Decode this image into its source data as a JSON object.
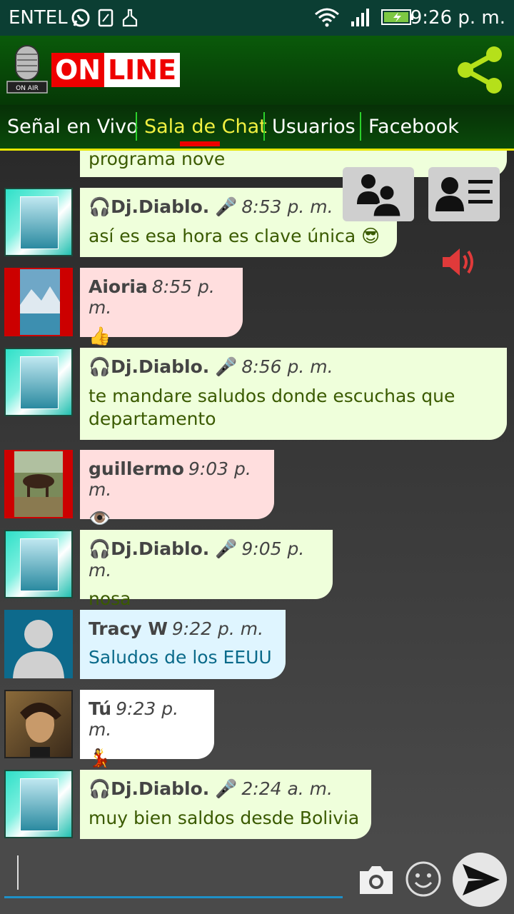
{
  "status_bar": {
    "carrier": "ENTEL",
    "time": "9:26 p. m.",
    "icons": [
      "whatsapp-icon",
      "screenshot-icon",
      "cleaner-icon",
      "wifi-icon",
      "signal-icon",
      "battery-charging-icon"
    ]
  },
  "header": {
    "logo_badge": "ON AIR",
    "logo_on": "ON",
    "logo_line": "LINE",
    "share_icon": "share-icon"
  },
  "tabs": [
    {
      "label": "Señal en Vivo"
    },
    {
      "label": "Sala de Chat"
    },
    {
      "label": "Usuarios"
    },
    {
      "label": "Facebook"
    }
  ],
  "active_tab": "Sala de Chat",
  "messages": [
    {
      "partial_text": "programa nove"
    },
    {
      "name": "Dj.Diablo.",
      "time": "8:53 p. m.",
      "text": "así es esa hora es clave única 😎",
      "avatar_label": "DJ.Diablo"
    },
    {
      "name": "Aioria",
      "time": "8:55 p. m.",
      "text": "👍"
    },
    {
      "name": "Dj.Diablo.",
      "time": "8:56 p. m.",
      "text": "te mandare saludos donde escuchas que departamento",
      "avatar_label": "DJ.Diablo"
    },
    {
      "name": "guillermo",
      "time": "9:03 p. m.",
      "text": "👁️"
    },
    {
      "name": "Dj.Diablo.",
      "time": "9:05 p. m.",
      "text": "nosa",
      "avatar_label": "DJ.Diablo"
    },
    {
      "name": "Tracy W",
      "time": "9:22 p. m.",
      "text": "Saludos de los EEUU"
    },
    {
      "name": "Tú",
      "time": "9:23 p. m.",
      "text": "💃"
    },
    {
      "name": "Dj.Diablo.",
      "time": "2:24 a. m.",
      "text": "muy bien saldos desde Bolivia",
      "avatar_label": "DJ.Diablo"
    }
  ],
  "input": {
    "value": "",
    "placeholder": ""
  },
  "colors": {
    "header_green": "#0a5a0a",
    "accent_yellow": "#f0f040",
    "tab_underline": "#e00000",
    "input_underline": "#1e90c8"
  }
}
